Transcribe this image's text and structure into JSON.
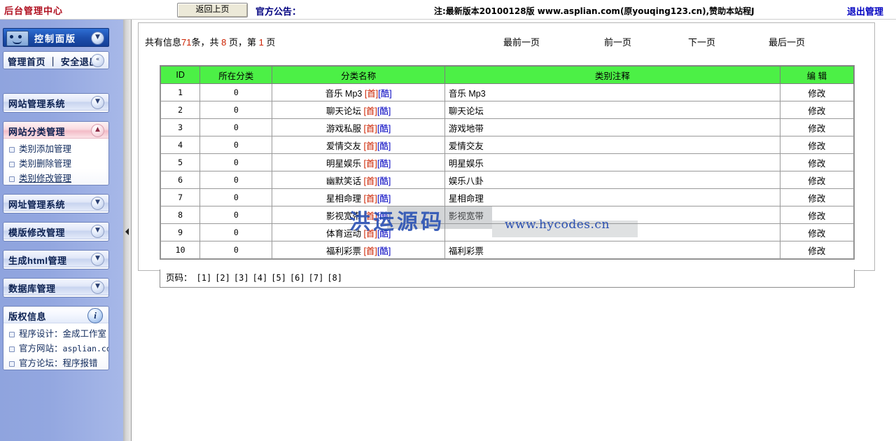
{
  "topbar": {
    "brand": "后台管理中心",
    "back_button": "返回上页",
    "notice_label": "官方公告：",
    "notice_text": "注:最新版本20100128版 www.asplian.com(原youqing123.cn),赞助本站程J",
    "logout": "退出管理"
  },
  "sidebar": {
    "control_panel": {
      "title": "控制面版",
      "toggle_icon": "chevron-down-icon"
    },
    "home_row": {
      "title": "管理首页 ｜ 安全退出",
      "toggle_icon": "chevron-left-icon"
    },
    "sections": [
      {
        "title": "网站管理系统",
        "toggle_icon": "chevron-down-icon",
        "expanded": false,
        "items": []
      },
      {
        "title": "网站分类管理",
        "toggle_icon": "chevron-up-icon",
        "expanded": true,
        "items": [
          {
            "label": "类别添加管理",
            "active": false
          },
          {
            "label": "类别删除管理",
            "active": false
          },
          {
            "label": "类别修改管理",
            "active": true
          }
        ]
      },
      {
        "title": "网址管理系统",
        "toggle_icon": "chevron-down-icon",
        "expanded": false,
        "items": []
      },
      {
        "title": "模版修改管理",
        "toggle_icon": "chevron-down-icon",
        "expanded": false,
        "items": []
      },
      {
        "title": "生成html管理",
        "toggle_icon": "chevron-down-icon",
        "expanded": false,
        "items": []
      },
      {
        "title": "数据库管理",
        "toggle_icon": "chevron-down-icon",
        "expanded": false,
        "items": []
      }
    ],
    "copyright": {
      "title": "版权信息",
      "icon": "info-icon",
      "lines": [
        {
          "label": "程序设计：",
          "value": "金成工作室",
          "mono": false
        },
        {
          "label": "官方网站：",
          "value": "asplian.com",
          "mono": true
        },
        {
          "label": "官方论坛：",
          "value": "程序报错",
          "mono": false
        }
      ]
    }
  },
  "main": {
    "info": {
      "prefix": "共有信息",
      "total": "71",
      "mid1": "条，共 ",
      "pages": "8",
      "mid2": " 页，第 ",
      "current": "1",
      "suffix": " 页"
    },
    "nav_links": [
      "最前一页",
      "前一页",
      "下一页",
      "最后一页"
    ],
    "table": {
      "headers": [
        "ID",
        "所在分类",
        "分类名称",
        "类别注释",
        "编 辑"
      ],
      "tag_shou": "[首]",
      "tag_ku": "[酷]",
      "edit_label": "修改",
      "rows": [
        {
          "id": "1",
          "cat": "0",
          "name": "音乐 Mp3",
          "note": "音乐 Mp3",
          "edit": "修改"
        },
        {
          "id": "2",
          "cat": "0",
          "name": "聊天论坛",
          "note": "聊天论坛",
          "edit": "修改"
        },
        {
          "id": "3",
          "cat": "0",
          "name": "游戏私服",
          "note": "游戏地带",
          "edit": "修改"
        },
        {
          "id": "4",
          "cat": "0",
          "name": "爱情交友",
          "note": "爱情交友",
          "edit": "修改"
        },
        {
          "id": "5",
          "cat": "0",
          "name": "明星娱乐",
          "note": "明星娱乐",
          "edit": "修改"
        },
        {
          "id": "6",
          "cat": "0",
          "name": "幽默笑话",
          "note": "娱乐八卦",
          "edit": "修改"
        },
        {
          "id": "7",
          "cat": "0",
          "name": "星相命理",
          "note": "星相命理",
          "edit": "修改"
        },
        {
          "id": "8",
          "cat": "0",
          "name": "影视宽带",
          "note": "影视宽带",
          "edit": "修改"
        },
        {
          "id": "9",
          "cat": "0",
          "name": "体育运动",
          "note": "",
          "edit": "修改"
        },
        {
          "id": "10",
          "cat": "0",
          "name": "福利彩票",
          "note": "福利彩票",
          "edit": "修改"
        }
      ]
    },
    "pager": {
      "label": "页码：",
      "pages": [
        "[1]",
        "[2]",
        "[3]",
        "[4]",
        "[5]",
        "[6]",
        "[7]",
        "[8]"
      ]
    }
  },
  "watermark": {
    "text": "洪运源码",
    "url": "www.hycodes.cn"
  },
  "colors": {
    "brand_red": "#b01020",
    "header_green": "#4cf046",
    "sidebar_blue": "#93a7e0",
    "link_blue": "#0000c0",
    "accent_red": "#cc2200"
  }
}
